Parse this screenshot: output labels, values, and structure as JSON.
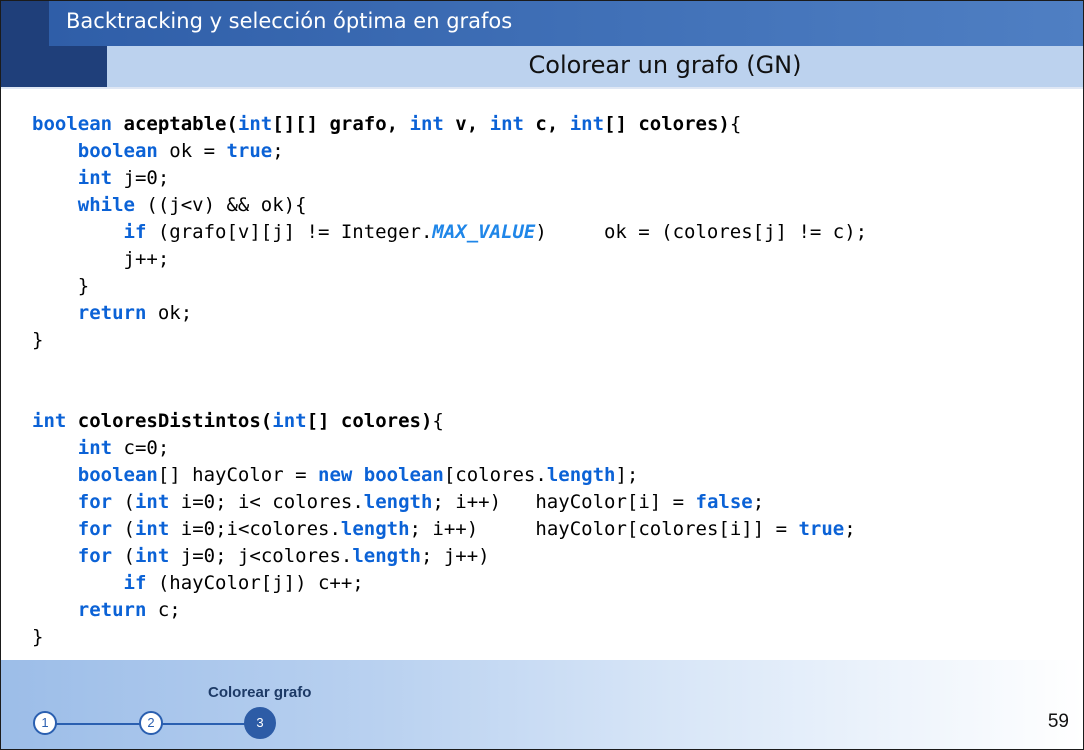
{
  "header": {
    "title": "Backtracking y selección óptima en grafos",
    "subtitle": "Colorear un grafo (GN)"
  },
  "code": {
    "block1": [
      [
        [
          "kw",
          "boolean"
        ],
        [
          "t",
          " "
        ],
        [
          "b",
          "aceptable("
        ],
        [
          "kw",
          "int"
        ],
        [
          "b",
          "[][] grafo, "
        ],
        [
          "kw",
          "int"
        ],
        [
          "b",
          " v, "
        ],
        [
          "kw",
          "int"
        ],
        [
          "b",
          " c, "
        ],
        [
          "kw",
          "int"
        ],
        [
          "b",
          "[] colores)"
        ],
        [
          "t",
          "{"
        ]
      ],
      [
        [
          "t",
          "    "
        ],
        [
          "kw",
          "boolean"
        ],
        [
          "t",
          " ok = "
        ],
        [
          "kw",
          "true"
        ],
        [
          "t",
          ";"
        ]
      ],
      [
        [
          "t",
          "    "
        ],
        [
          "kw",
          "int"
        ],
        [
          "t",
          " j=0;"
        ]
      ],
      [
        [
          "t",
          "    "
        ],
        [
          "kw",
          "while"
        ],
        [
          "t",
          " ((j<v) && ok){"
        ]
      ],
      [
        [
          "t",
          "        "
        ],
        [
          "kw",
          "if"
        ],
        [
          "t",
          " (grafo[v][j] != Integer."
        ],
        [
          "const",
          "MAX_VALUE"
        ],
        [
          "t",
          ")     ok = (colores[j] != c);"
        ]
      ],
      [
        [
          "t",
          "        j++;"
        ]
      ],
      [
        [
          "t",
          "    }"
        ]
      ],
      [
        [
          "t",
          "    "
        ],
        [
          "kw",
          "return"
        ],
        [
          "t",
          " ok;"
        ]
      ],
      [
        [
          "t",
          "}"
        ]
      ]
    ],
    "block2": [
      [
        [
          "kw",
          "int"
        ],
        [
          "t",
          " "
        ],
        [
          "b",
          "coloresDistintos("
        ],
        [
          "kw",
          "int"
        ],
        [
          "b",
          "[] colores)"
        ],
        [
          "t",
          "{"
        ]
      ],
      [
        [
          "t",
          "    "
        ],
        [
          "kw",
          "int"
        ],
        [
          "t",
          " c=0;"
        ]
      ],
      [
        [
          "t",
          "    "
        ],
        [
          "kw",
          "boolean"
        ],
        [
          "t",
          "[] hayColor = "
        ],
        [
          "kw",
          "new"
        ],
        [
          "t",
          " "
        ],
        [
          "kw",
          "boolean"
        ],
        [
          "t",
          "[colores."
        ],
        [
          "kw",
          "length"
        ],
        [
          "t",
          "];"
        ]
      ],
      [
        [
          "t",
          "    "
        ],
        [
          "kw",
          "for"
        ],
        [
          "t",
          " ("
        ],
        [
          "kw",
          "int"
        ],
        [
          "t",
          " i=0; i< colores."
        ],
        [
          "kw",
          "length"
        ],
        [
          "t",
          "; i++)   hayColor[i] = "
        ],
        [
          "kw",
          "false"
        ],
        [
          "t",
          ";"
        ]
      ],
      [
        [
          "t",
          "    "
        ],
        [
          "kw",
          "for"
        ],
        [
          "t",
          " ("
        ],
        [
          "kw",
          "int"
        ],
        [
          "t",
          " i=0;i<colores."
        ],
        [
          "kw",
          "length"
        ],
        [
          "t",
          "; i++)     hayColor[colores[i]] = "
        ],
        [
          "kw",
          "true"
        ],
        [
          "t",
          ";"
        ]
      ],
      [
        [
          "t",
          "    "
        ],
        [
          "kw",
          "for"
        ],
        [
          "t",
          " ("
        ],
        [
          "kw",
          "int"
        ],
        [
          "t",
          " j=0; j<colores."
        ],
        [
          "kw",
          "length"
        ],
        [
          "t",
          "; j++)"
        ]
      ],
      [
        [
          "t",
          "        "
        ],
        [
          "kw",
          "if"
        ],
        [
          "t",
          " (hayColor[j]) c++;"
        ]
      ],
      [
        [
          "t",
          "    "
        ],
        [
          "kw",
          "return"
        ],
        [
          "t",
          " c;"
        ]
      ],
      [
        [
          "t",
          "}"
        ]
      ]
    ]
  },
  "footer": {
    "section_label": "Colorear grafo",
    "steps": [
      "1",
      "2",
      "3"
    ],
    "active_step": "3",
    "page_number": "59"
  },
  "colors": {
    "keyword": "#0b62d6",
    "constant": "#1f86e8",
    "header_blue": "#3f6fb6",
    "header_dark": "#1f3f7a",
    "subheader": "#bcd2ee"
  }
}
